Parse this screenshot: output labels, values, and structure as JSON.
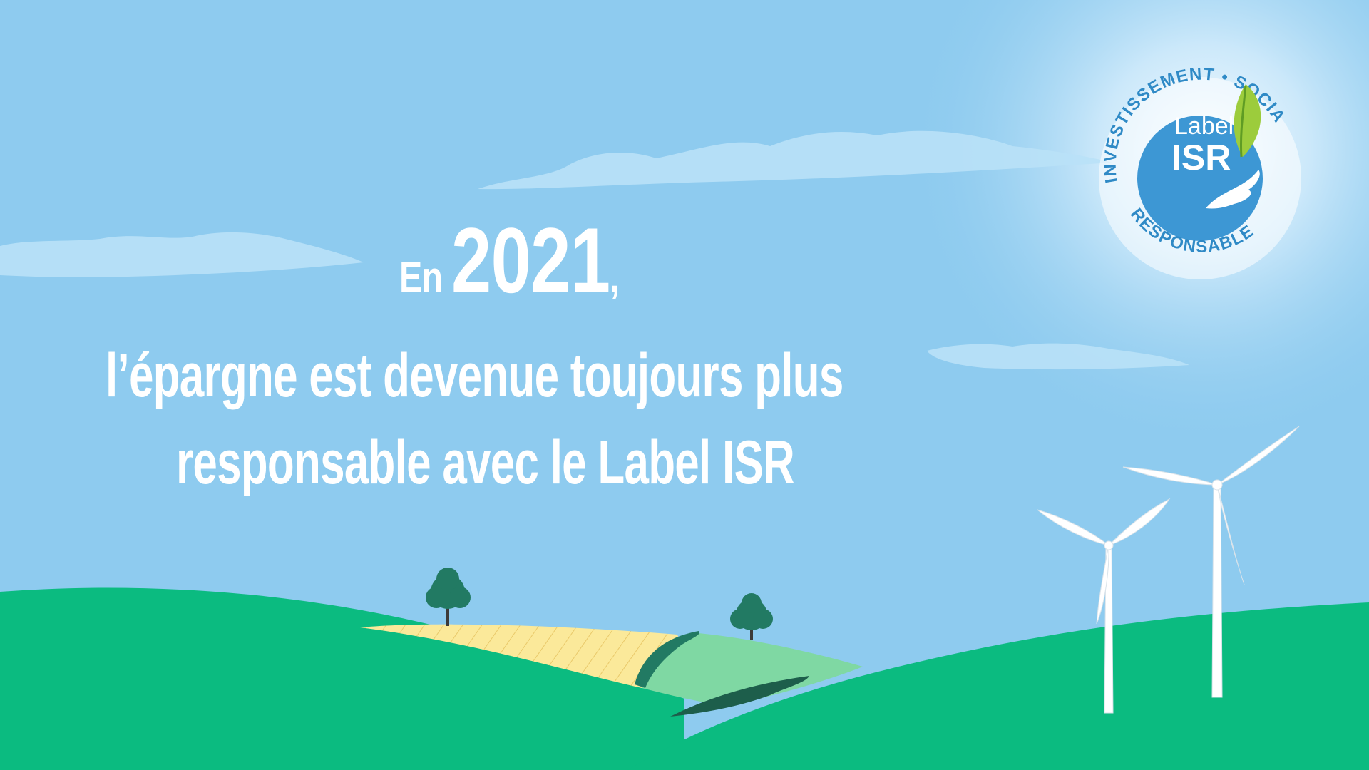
{
  "headline": {
    "prefix": "En",
    "year": "2021",
    "suffix": ",",
    "line2": "l’épargne est devenue toujours plus",
    "line3": "responsable avec le Label ISR"
  },
  "logo": {
    "arc_top": "INVESTISSEMENT • SOCIALEMENT",
    "arc_bottom": "RESPONSABLE",
    "label_small": "Label",
    "label_big": "ISR",
    "icon": "leaf-in-hand-icon"
  },
  "colors": {
    "sky": "#8ecbef",
    "hill_green": "#0bbb80",
    "field_yellow": "#fbe99a",
    "field_light_green": "#7fd8a3",
    "tree_dark": "#227a63",
    "logo_blue": "#3d97d4",
    "text": "#ffffff"
  }
}
